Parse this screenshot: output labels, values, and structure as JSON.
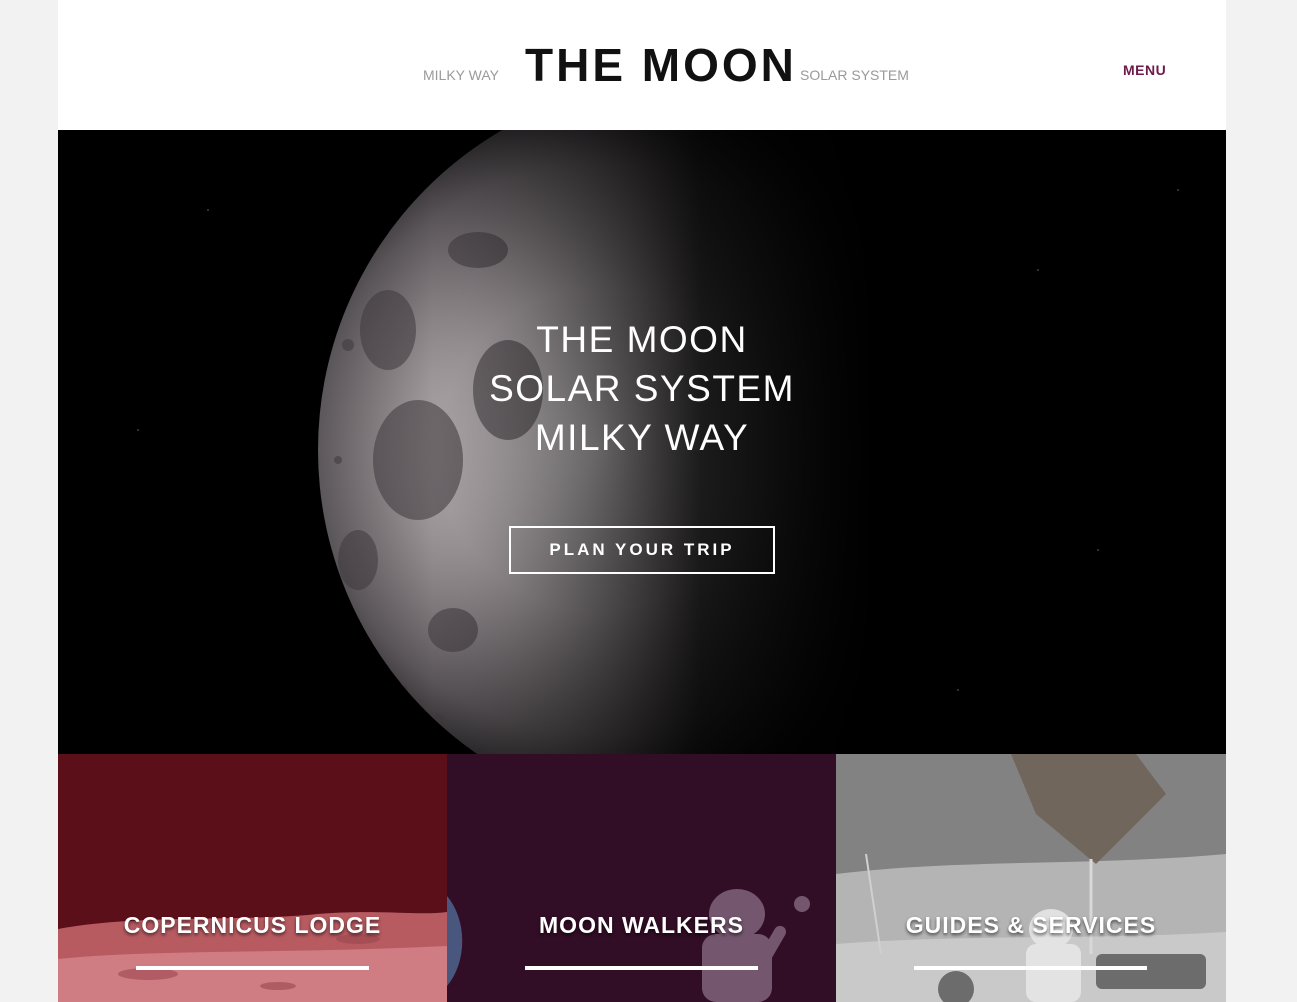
{
  "header": {
    "nav_left": "MILKY WAY",
    "brand": "THE MOON",
    "nav_right": "SOLAR SYSTEM",
    "menu": "MENU"
  },
  "hero": {
    "lines": [
      "THE MOON",
      "SOLAR SYSTEM",
      "MILKY WAY"
    ],
    "cta_label": "PLAN YOUR TRIP"
  },
  "tiles": [
    {
      "title": "COPERNICUS LODGE",
      "color": "#5b0f19"
    },
    {
      "title": "MOON WALKERS",
      "color": "#320d26"
    },
    {
      "title": "GUIDES & SERVICES",
      "color": "#858585"
    }
  ],
  "colors": {
    "menu_accent": "#6e1a4a",
    "page_bg": "#f2f2f2",
    "hero_bg": "#000000"
  }
}
